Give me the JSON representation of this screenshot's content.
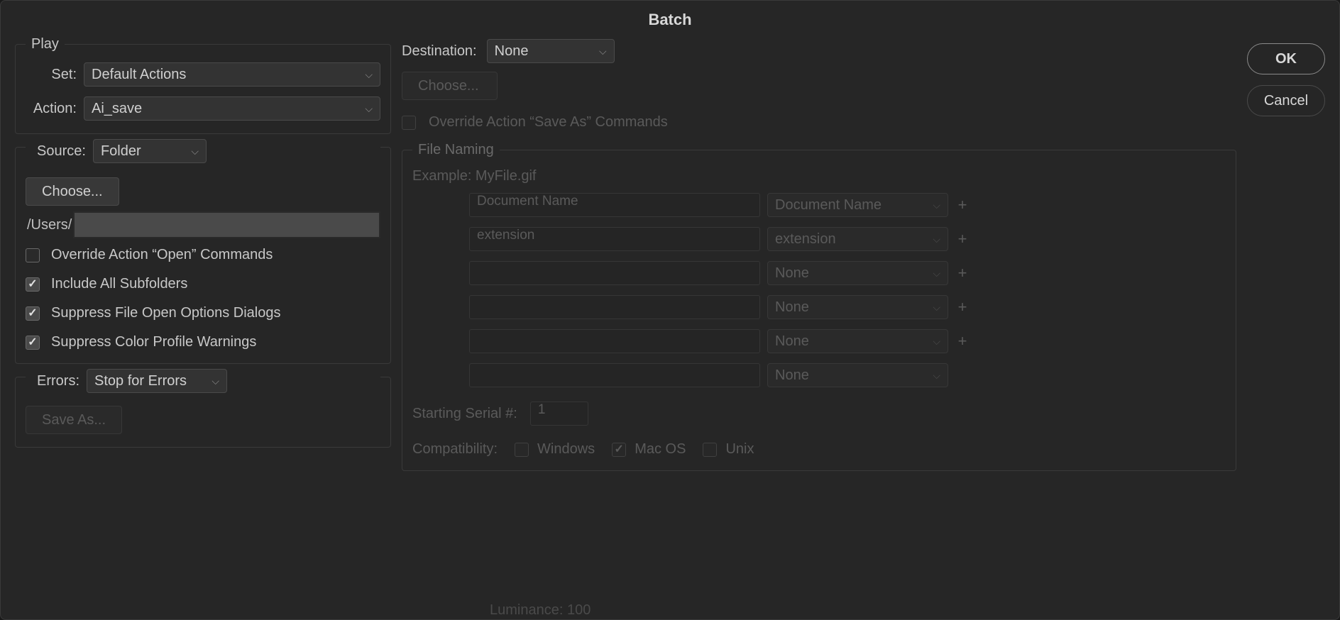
{
  "dialog": {
    "title": "Batch"
  },
  "play": {
    "legend": "Play",
    "set_label": "Set:",
    "set_value": "Default Actions",
    "action_label": "Action:",
    "action_value": "Ai_save"
  },
  "source": {
    "label": "Source:",
    "value": "Folder",
    "choose_label": "Choose...",
    "path_prefix": "/Users/",
    "override_open": "Override Action “Open” Commands",
    "include_subfolders": "Include All Subfolders",
    "suppress_dialogs": "Suppress File Open Options Dialogs",
    "suppress_color": "Suppress Color Profile Warnings",
    "checks": {
      "override_open": false,
      "include_subfolders": true,
      "suppress_dialogs": true,
      "suppress_color": true
    }
  },
  "errors": {
    "label": "Errors:",
    "value": "Stop for Errors",
    "save_as_label": "Save As..."
  },
  "destination": {
    "label": "Destination:",
    "value": "None",
    "choose_label": "Choose...",
    "override_saveas": "Override Action “Save As” Commands"
  },
  "file_naming": {
    "legend": "File Naming",
    "example": "Example: MyFile.gif",
    "rows": [
      {
        "placeholder": "Document Name",
        "select": "Document Name",
        "plus": true
      },
      {
        "placeholder": "extension",
        "select": "extension",
        "plus": true
      },
      {
        "placeholder": "",
        "select": "None",
        "plus": true
      },
      {
        "placeholder": "",
        "select": "None",
        "plus": true
      },
      {
        "placeholder": "",
        "select": "None",
        "plus": true
      },
      {
        "placeholder": "",
        "select": "None",
        "plus": false
      }
    ],
    "serial_label": "Starting Serial #:",
    "serial_value": "1",
    "compat_label": "Compatibility:",
    "compat": {
      "windows": "Windows",
      "macos": "Mac OS",
      "unix": "Unix"
    },
    "compat_checked": {
      "windows": false,
      "macos": true,
      "unix": false
    }
  },
  "buttons": {
    "ok": "OK",
    "cancel": "Cancel"
  },
  "background": {
    "luminance": "Luminance: 100"
  }
}
